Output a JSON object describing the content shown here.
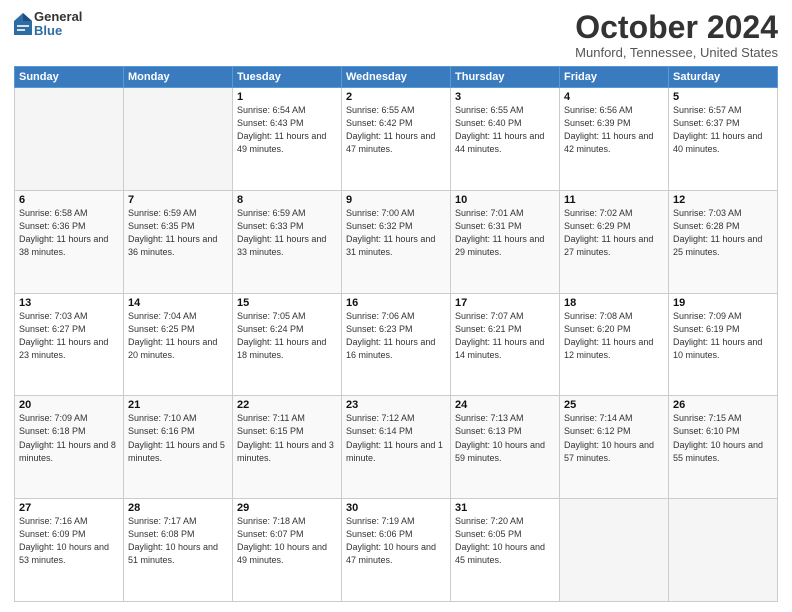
{
  "header": {
    "logo_general": "General",
    "logo_blue": "Blue",
    "month_title": "October 2024",
    "location": "Munford, Tennessee, United States"
  },
  "days_of_week": [
    "Sunday",
    "Monday",
    "Tuesday",
    "Wednesday",
    "Thursday",
    "Friday",
    "Saturday"
  ],
  "weeks": [
    [
      {
        "day": "",
        "empty": true
      },
      {
        "day": "",
        "empty": true
      },
      {
        "day": "1",
        "sunrise": "6:54 AM",
        "sunset": "6:43 PM",
        "daylight": "11 hours and 49 minutes."
      },
      {
        "day": "2",
        "sunrise": "6:55 AM",
        "sunset": "6:42 PM",
        "daylight": "11 hours and 47 minutes."
      },
      {
        "day": "3",
        "sunrise": "6:55 AM",
        "sunset": "6:40 PM",
        "daylight": "11 hours and 44 minutes."
      },
      {
        "day": "4",
        "sunrise": "6:56 AM",
        "sunset": "6:39 PM",
        "daylight": "11 hours and 42 minutes."
      },
      {
        "day": "5",
        "sunrise": "6:57 AM",
        "sunset": "6:37 PM",
        "daylight": "11 hours and 40 minutes."
      }
    ],
    [
      {
        "day": "6",
        "sunrise": "6:58 AM",
        "sunset": "6:36 PM",
        "daylight": "11 hours and 38 minutes."
      },
      {
        "day": "7",
        "sunrise": "6:59 AM",
        "sunset": "6:35 PM",
        "daylight": "11 hours and 36 minutes."
      },
      {
        "day": "8",
        "sunrise": "6:59 AM",
        "sunset": "6:33 PM",
        "daylight": "11 hours and 33 minutes."
      },
      {
        "day": "9",
        "sunrise": "7:00 AM",
        "sunset": "6:32 PM",
        "daylight": "11 hours and 31 minutes."
      },
      {
        "day": "10",
        "sunrise": "7:01 AM",
        "sunset": "6:31 PM",
        "daylight": "11 hours and 29 minutes."
      },
      {
        "day": "11",
        "sunrise": "7:02 AM",
        "sunset": "6:29 PM",
        "daylight": "11 hours and 27 minutes."
      },
      {
        "day": "12",
        "sunrise": "7:03 AM",
        "sunset": "6:28 PM",
        "daylight": "11 hours and 25 minutes."
      }
    ],
    [
      {
        "day": "13",
        "sunrise": "7:03 AM",
        "sunset": "6:27 PM",
        "daylight": "11 hours and 23 minutes."
      },
      {
        "day": "14",
        "sunrise": "7:04 AM",
        "sunset": "6:25 PM",
        "daylight": "11 hours and 20 minutes."
      },
      {
        "day": "15",
        "sunrise": "7:05 AM",
        "sunset": "6:24 PM",
        "daylight": "11 hours and 18 minutes."
      },
      {
        "day": "16",
        "sunrise": "7:06 AM",
        "sunset": "6:23 PM",
        "daylight": "11 hours and 16 minutes."
      },
      {
        "day": "17",
        "sunrise": "7:07 AM",
        "sunset": "6:21 PM",
        "daylight": "11 hours and 14 minutes."
      },
      {
        "day": "18",
        "sunrise": "7:08 AM",
        "sunset": "6:20 PM",
        "daylight": "11 hours and 12 minutes."
      },
      {
        "day": "19",
        "sunrise": "7:09 AM",
        "sunset": "6:19 PM",
        "daylight": "11 hours and 10 minutes."
      }
    ],
    [
      {
        "day": "20",
        "sunrise": "7:09 AM",
        "sunset": "6:18 PM",
        "daylight": "11 hours and 8 minutes."
      },
      {
        "day": "21",
        "sunrise": "7:10 AM",
        "sunset": "6:16 PM",
        "daylight": "11 hours and 5 minutes."
      },
      {
        "day": "22",
        "sunrise": "7:11 AM",
        "sunset": "6:15 PM",
        "daylight": "11 hours and 3 minutes."
      },
      {
        "day": "23",
        "sunrise": "7:12 AM",
        "sunset": "6:14 PM",
        "daylight": "11 hours and 1 minute."
      },
      {
        "day": "24",
        "sunrise": "7:13 AM",
        "sunset": "6:13 PM",
        "daylight": "10 hours and 59 minutes."
      },
      {
        "day": "25",
        "sunrise": "7:14 AM",
        "sunset": "6:12 PM",
        "daylight": "10 hours and 57 minutes."
      },
      {
        "day": "26",
        "sunrise": "7:15 AM",
        "sunset": "6:10 PM",
        "daylight": "10 hours and 55 minutes."
      }
    ],
    [
      {
        "day": "27",
        "sunrise": "7:16 AM",
        "sunset": "6:09 PM",
        "daylight": "10 hours and 53 minutes."
      },
      {
        "day": "28",
        "sunrise": "7:17 AM",
        "sunset": "6:08 PM",
        "daylight": "10 hours and 51 minutes."
      },
      {
        "day": "29",
        "sunrise": "7:18 AM",
        "sunset": "6:07 PM",
        "daylight": "10 hours and 49 minutes."
      },
      {
        "day": "30",
        "sunrise": "7:19 AM",
        "sunset": "6:06 PM",
        "daylight": "10 hours and 47 minutes."
      },
      {
        "day": "31",
        "sunrise": "7:20 AM",
        "sunset": "6:05 PM",
        "daylight": "10 hours and 45 minutes."
      },
      {
        "day": "",
        "empty": true
      },
      {
        "day": "",
        "empty": true
      }
    ]
  ]
}
